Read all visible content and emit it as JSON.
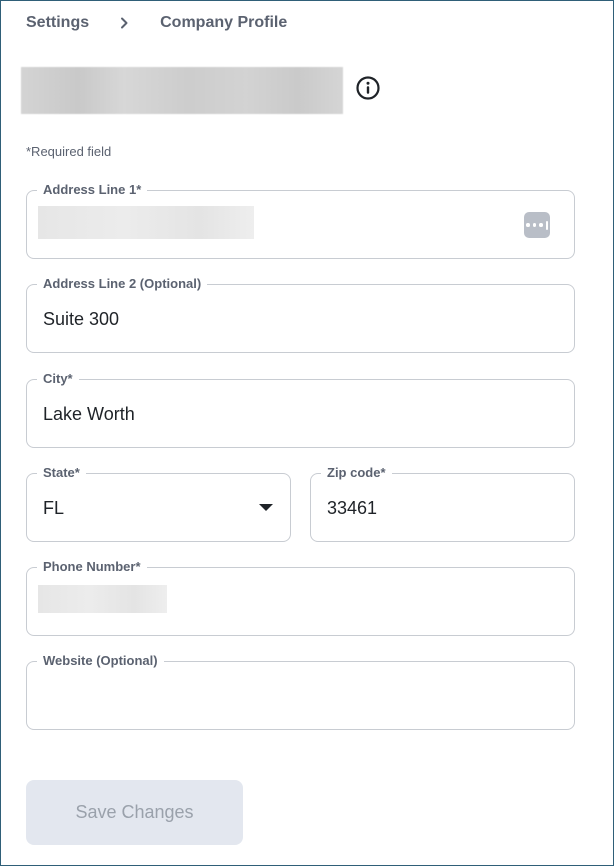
{
  "breadcrumb": {
    "items": [
      "Settings",
      "Company Profile"
    ]
  },
  "required_note": "*Required field",
  "form": {
    "address_line1": {
      "label": "Address Line 1*",
      "value": ""
    },
    "address_line2": {
      "label": "Address Line 2 (Optional)",
      "value": "Suite 300"
    },
    "city": {
      "label": "City*",
      "value": "Lake Worth"
    },
    "state": {
      "label": "State*",
      "value": "FL"
    },
    "zip": {
      "label": "Zip code*",
      "value": "33461"
    },
    "phone": {
      "label": "Phone Number*",
      "value": ""
    },
    "website": {
      "label": "Website (Optional)",
      "value": ""
    }
  },
  "actions": {
    "save_label": "Save Changes"
  },
  "icons": {
    "separator": "chevron-right-icon",
    "info": "info-icon",
    "autofill": "password-autofill-icon",
    "dropdown": "caret-down-icon"
  },
  "colors": {
    "border": "#c8ccd2",
    "label": "#5b6270",
    "disabled_button_bg": "#e3e7ef",
    "disabled_button_text": "#9aa1ab",
    "frame": "#2f5f78"
  }
}
